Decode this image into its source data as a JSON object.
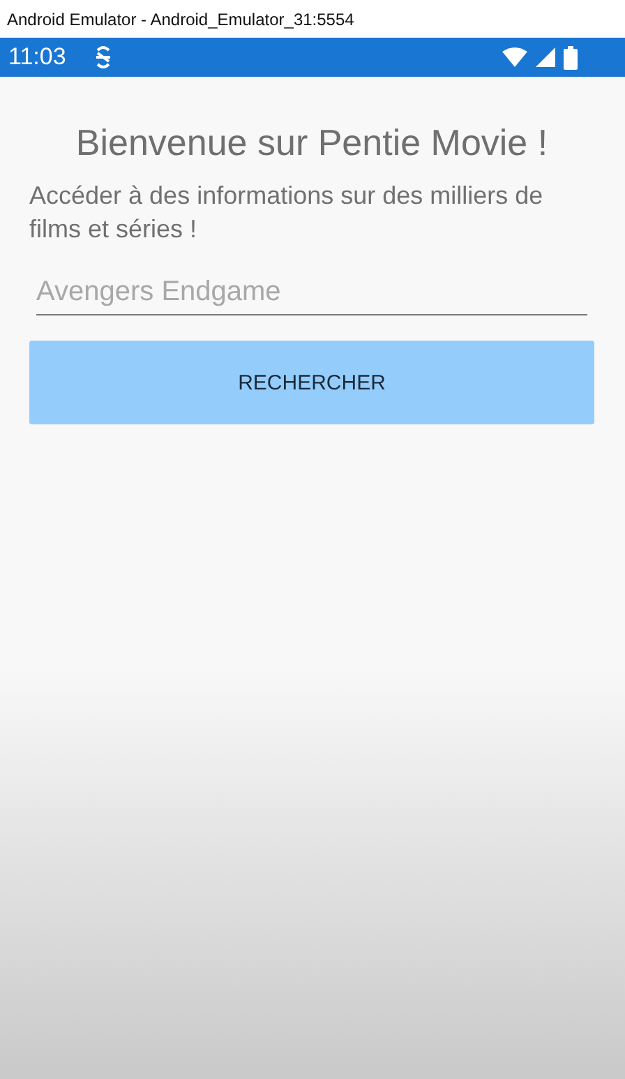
{
  "window": {
    "title": "Android Emulator - Android_Emulator_31:5554"
  },
  "status_bar": {
    "time": "11:03"
  },
  "heading": "Bienvenue sur Pentie Movie !",
  "subtitle": "Accéder à des informations sur des milliers de films et séries !",
  "search": {
    "placeholder": "Avengers Endgame"
  },
  "buttons": [
    {
      "label": "RECHERCHER"
    }
  ]
}
